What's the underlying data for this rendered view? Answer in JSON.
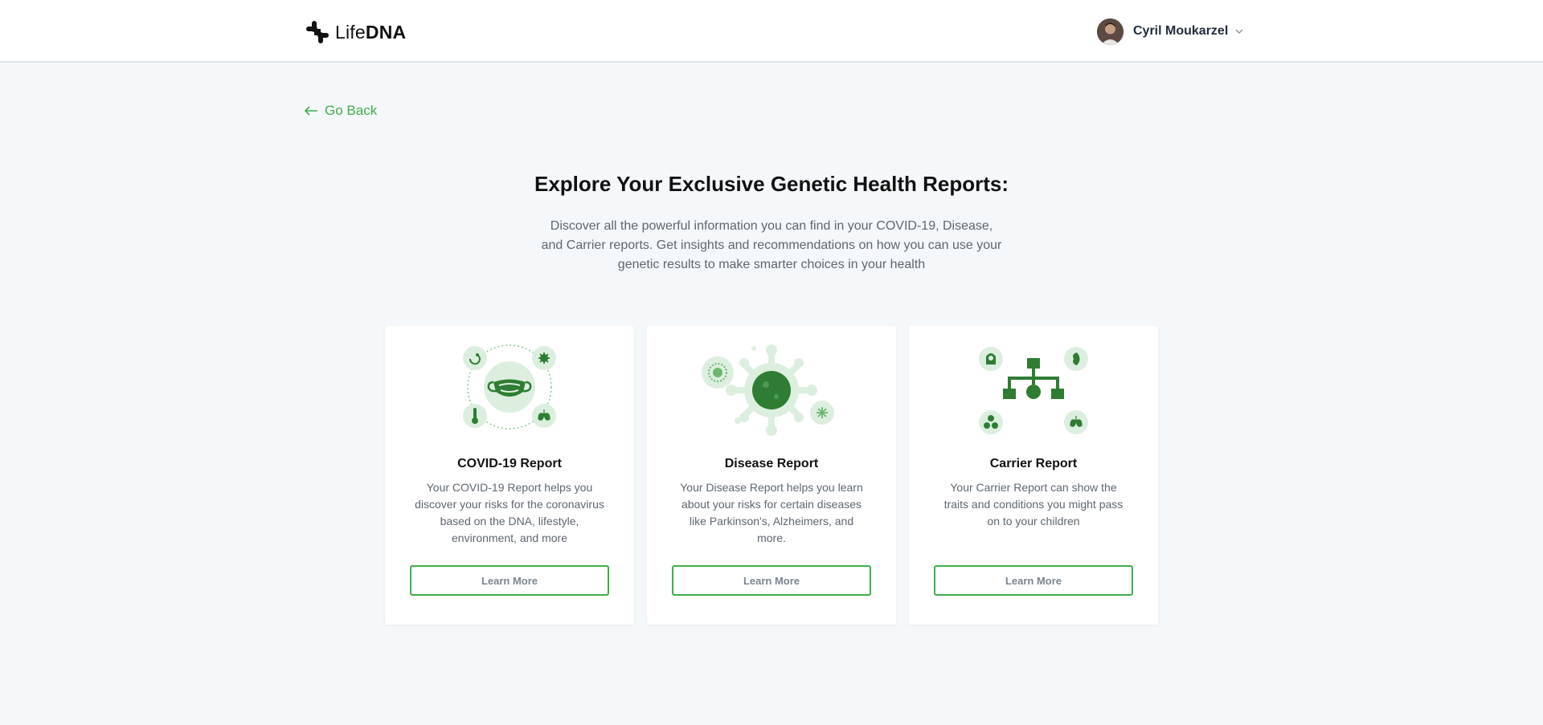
{
  "header": {
    "logo_light": "Life",
    "logo_bold": "DNA",
    "user_name": "Cyril Moukarzel"
  },
  "nav": {
    "go_back_label": "Go Back"
  },
  "main": {
    "title": "Explore Your Exclusive Genetic Health Reports:",
    "subtitle": "Discover all the powerful information you can find in your COVID-19, Disease, and Carrier reports. Get insights and recommendations on how you can use your genetic results to make smarter choices in your health"
  },
  "cards": [
    {
      "title": "COVID-19 Report",
      "description": "Your COVID-19 Report helps you discover your risks for the coronavirus based on the DNA, lifestyle, environment, and more",
      "button_label": "Learn More",
      "icon": "mask-icon"
    },
    {
      "title": "Disease Report",
      "description": "Your Disease Report helps you learn about your risks for certain diseases like Parkinson's, Alzheimers, and more.",
      "button_label": "Learn More",
      "icon": "virus-icon"
    },
    {
      "title": "Carrier Report",
      "description": "Your Carrier Report can show the traits and conditions you might pass on to your children",
      "button_label": "Learn More",
      "icon": "family-tree-icon"
    }
  ],
  "colors": {
    "accent": "#3fae49",
    "icon_dark": "#2e7d32",
    "icon_light": "#dcefdf",
    "background": "#f5f8fa"
  }
}
